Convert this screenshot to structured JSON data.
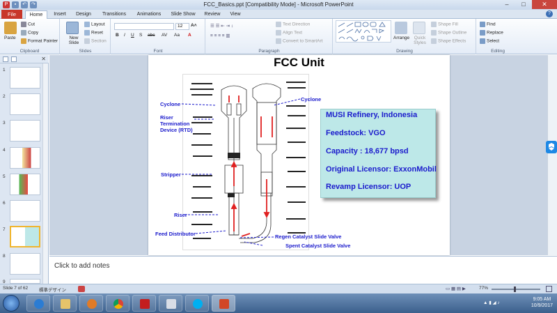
{
  "window": {
    "title": "FCC_Basics.ppt [Compatibility Mode] - Microsoft PowerPoint"
  },
  "tabs": [
    "File",
    "Home",
    "Insert",
    "Design",
    "Transitions",
    "Animations",
    "Slide Show",
    "Review",
    "View"
  ],
  "ribbon": {
    "clipboard": {
      "label": "Clipboard",
      "paste": "Paste",
      "cut": "Cut",
      "copy": "Copy",
      "format_painter": "Format Painter"
    },
    "slides": {
      "label": "Slides",
      "new_slide": "New Slide",
      "layout": "Layout",
      "reset": "Reset",
      "section": "Section"
    },
    "font": {
      "label": "Font",
      "size": "12"
    },
    "paragraph": {
      "label": "Paragraph",
      "text_direction": "Text Direction",
      "align_text": "Align Text",
      "convert_smartart": "Convert to SmartArt"
    },
    "drawing": {
      "label": "Drawing",
      "arrange": "Arrange",
      "quick_styles": "Quick Styles",
      "shape_fill": "Shape Fill",
      "shape_outline": "Shape Outline",
      "shape_effects": "Shape Effects"
    },
    "editing": {
      "label": "Editing",
      "find": "Find",
      "replace": "Replace",
      "select": "Select"
    }
  },
  "thumbnails": [
    "1",
    "2",
    "3",
    "4",
    "5",
    "6",
    "7",
    "8",
    "9"
  ],
  "slide": {
    "title": "FCC Unit",
    "callouts": {
      "cyclone_left": "Cyclone",
      "cyclone_right": "Cyclone",
      "rtd": [
        "Riser",
        "Termination",
        "Device (RTD)"
      ],
      "stripper": "Stripper",
      "riser": "Riser",
      "feed": "Feed Distributor",
      "regen_valve": "Regen Catalyst Slide Valve",
      "spent_valve": "Spent Catalyst Slide Valve"
    },
    "info": [
      "MUSI Refinery, Indonesia",
      "Feedstock: VGO",
      "Capacity : 18,677 bpsd",
      "Original Licensor: ExxonMobil",
      "Revamp Licensor: UOP"
    ]
  },
  "notes": {
    "placeholder": "Click to add notes"
  },
  "status": {
    "slide": "Slide 7 of 62",
    "theme": "標準デザイン",
    "zoom": "77%"
  },
  "clock": {
    "time": "9:05 AM",
    "date": "10/9/2017"
  }
}
